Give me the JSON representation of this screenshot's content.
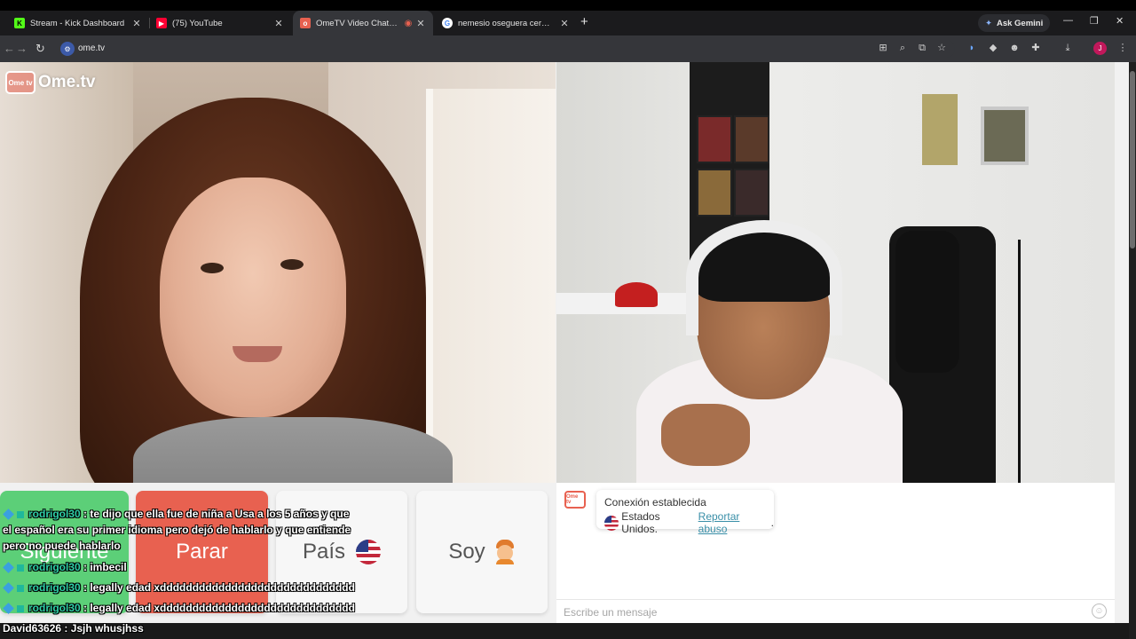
{
  "browser": {
    "tabs": [
      {
        "label": "Stream - Kick Dashboard",
        "favicon": "kick-icon",
        "color": "#53fc18"
      },
      {
        "label": "(75) YouTube",
        "favicon": "youtube-icon",
        "color": "#ff0033"
      },
      {
        "label": "OmeTV Video Chat — Ome",
        "favicon": "ometv-icon",
        "color": "#e86150",
        "active": true
      },
      {
        "label": "nemesio oseguera cervantes - ",
        "favicon": "google-icon",
        "color": "#4285f4"
      }
    ],
    "new_tab": "+",
    "gemini_label": "Ask Gemini",
    "url": "ome.tv",
    "profile_initial": "J"
  },
  "app": {
    "logo_box": "Ome tv",
    "logo_text": "Ome.tv"
  },
  "controls": {
    "next_label": "Siguiente",
    "stop_label": "Parar",
    "country_label": "País",
    "me_label": "Soy"
  },
  "chat": {
    "message_line1": "Conexión establecida",
    "message_country": "Estados Unidos.",
    "message_report": "Reportar abuso",
    "input_placeholder": "Escribe un mensaje",
    "logo_box": "Ome tv"
  },
  "stream_overlay": {
    "messages": [
      {
        "user": "rodrigol30",
        "text": " : te dijo que ella fue de niña a Usa a los 5 años y que el español era su primer idioma pero dejó de hablarlo y que entiende pero no puede hablarlo"
      },
      {
        "user": "rodrigol30",
        "text": " : imbecil"
      },
      {
        "user": "rodrigol30",
        "text": " : legally edad xdddddddddddddddddddddddddddddd"
      },
      {
        "user": "rodrigol30",
        "text": " : legally edad xdddddddddddddddddddddddddddddd"
      },
      {
        "user": "David63626",
        "text": " : Jsjh whusjhss"
      }
    ]
  }
}
